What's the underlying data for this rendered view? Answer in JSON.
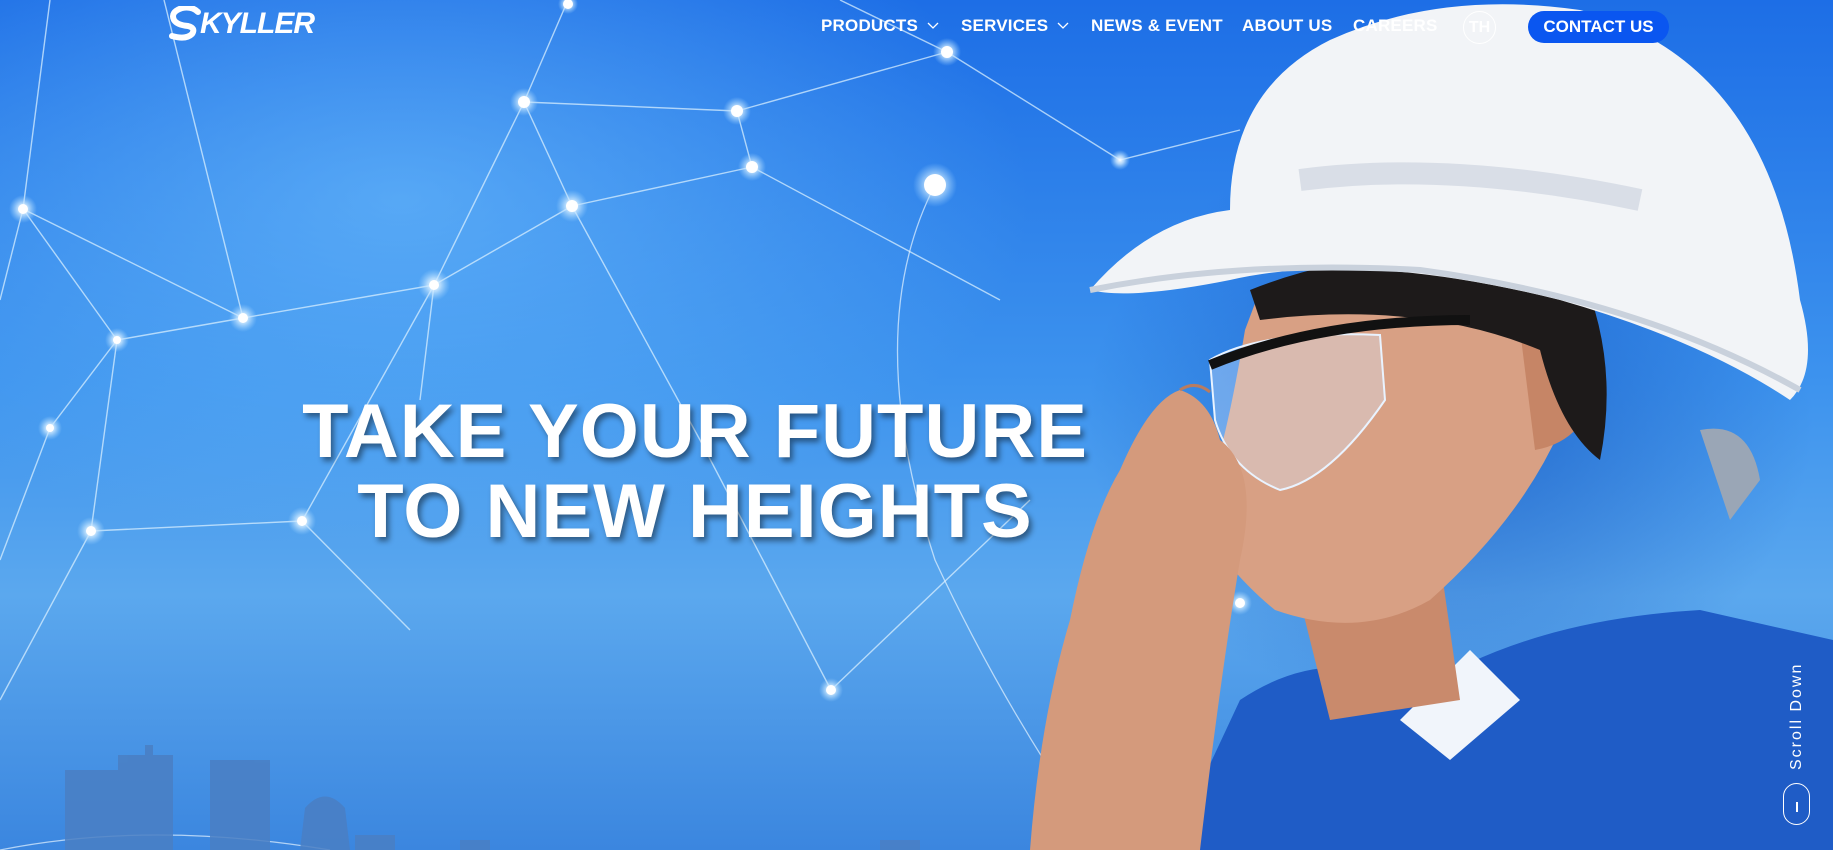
{
  "brand": {
    "name": "KYLLER"
  },
  "nav": {
    "items": [
      {
        "label": "PRODUCTS",
        "has_dropdown": true
      },
      {
        "label": "SERVICES",
        "has_dropdown": true
      },
      {
        "label": "NEWS & EVENT",
        "has_dropdown": false
      },
      {
        "label": "ABOUT US",
        "has_dropdown": false
      },
      {
        "label": "CAREERS",
        "has_dropdown": false
      }
    ],
    "language": "TH",
    "contact_label": "CONTACT US"
  },
  "hero": {
    "headline_line1": "TAKE YOUR FUTURE",
    "headline_line2": "TO NEW HEIGHTS",
    "scroll_label": "Scroll Down"
  },
  "colors": {
    "accent": "#0a56f0",
    "sky": "#2f86e8",
    "text": "#ffffff"
  }
}
